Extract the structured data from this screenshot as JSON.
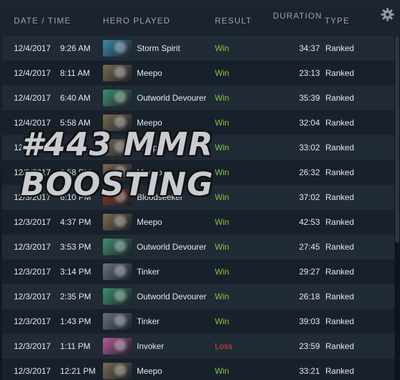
{
  "header": {
    "date_time": "DATE / TIME",
    "hero_played": "HERO PLAYED",
    "result": "RESULT",
    "duration": "DURATION",
    "type": "TYPE"
  },
  "settings_icon": "gear-icon",
  "overlay": {
    "line1": "#443 MMR",
    "line2": "BOOSTING"
  },
  "portrait_colors": {
    "Storm Spirit": "#3e8aa8",
    "Meepo": "#7a6a52",
    "Outworld Devourer": "#3f8f6e",
    "Bloodseeker": "#8a3a26",
    "Tinker": "#6a6f86",
    "Invoker": "#b85a9a"
  },
  "matches": [
    {
      "date": "12/4/2017",
      "time": "9:26 AM",
      "hero": "Storm Spirit",
      "result": "Win",
      "duration": "34:37",
      "type": "Ranked"
    },
    {
      "date": "12/4/2017",
      "time": "8:11 AM",
      "hero": "Meepo",
      "result": "Win",
      "duration": "23:13",
      "type": "Ranked"
    },
    {
      "date": "12/4/2017",
      "time": "6:40 AM",
      "hero": "Outworld Devourer",
      "result": "Win",
      "duration": "35:39",
      "type": "Ranked"
    },
    {
      "date": "12/4/2017",
      "time": "5:58 AM",
      "hero": "Meepo",
      "result": "Win",
      "duration": "32:04",
      "type": "Ranked"
    },
    {
      "date": "12/3/2017",
      "time": "",
      "hero": "Meepo",
      "result": "Win",
      "duration": "33:02",
      "type": "Ranked"
    },
    {
      "date": "12/3/2017",
      "time": "6:58 PM",
      "hero": "Meepo",
      "result": "Win",
      "duration": "26:32",
      "type": "Ranked"
    },
    {
      "date": "12/3/2017",
      "time": "6:10 PM",
      "hero": "Bloodseeker",
      "result": "Win",
      "duration": "37:02",
      "type": "Ranked"
    },
    {
      "date": "12/3/2017",
      "time": "4:37 PM",
      "hero": "Meepo",
      "result": "Win",
      "duration": "42:53",
      "type": "Ranked"
    },
    {
      "date": "12/3/2017",
      "time": "3:53 PM",
      "hero": "Outworld Devourer",
      "result": "Win",
      "duration": "27:45",
      "type": "Ranked"
    },
    {
      "date": "12/3/2017",
      "time": "3:14 PM",
      "hero": "Tinker",
      "result": "Win",
      "duration": "29:27",
      "type": "Ranked"
    },
    {
      "date": "12/3/2017",
      "time": "2:35 PM",
      "hero": "Outworld Devourer",
      "result": "Win",
      "duration": "26:18",
      "type": "Ranked"
    },
    {
      "date": "12/3/2017",
      "time": "1:43 PM",
      "hero": "Tinker",
      "result": "Win",
      "duration": "39:03",
      "type": "Ranked"
    },
    {
      "date": "12/3/2017",
      "time": "1:11 PM",
      "hero": "Invoker",
      "result": "Loss",
      "duration": "23:59",
      "type": "Ranked"
    },
    {
      "date": "12/3/2017",
      "time": "12:21 PM",
      "hero": "Meepo",
      "result": "Win",
      "duration": "33:21",
      "type": "Ranked"
    }
  ]
}
